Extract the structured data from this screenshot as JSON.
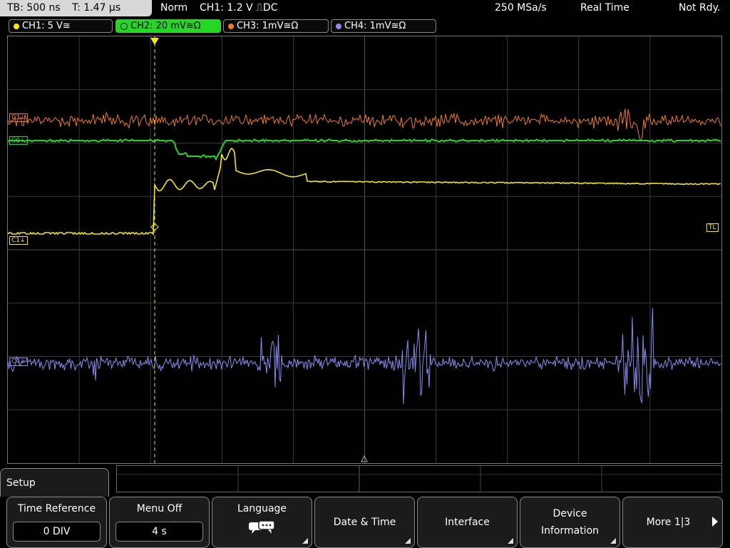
{
  "status": {
    "timebase": "TB: 500 ns",
    "trigger_time": "T: 1.47 µs",
    "mode": "Norm",
    "trigger_source": "CH1: 1.2 V ⎍DC",
    "sample_rate": "250 MSa/s",
    "acquisition": "Real Time",
    "state": "Not Rdy."
  },
  "channels": [
    {
      "label": "CH1: 5 V≅",
      "color": "#f4e81a",
      "active": false
    },
    {
      "label": "CH2: 20 mV≅Ω",
      "color": "#26d626",
      "active": true
    },
    {
      "label": "CH3: 1mV≅Ω",
      "color": "#f07a2a",
      "active": false
    },
    {
      "label": "CH4: 1mV≅Ω",
      "color": "#8a8cf0",
      "active": false
    }
  ],
  "markers": {
    "c1": "C1↓",
    "c2": "C2↓",
    "c3": "C3↓",
    "c4": "C4↓",
    "trigger_level": "TL",
    "trigger_pos": "T"
  },
  "menu": {
    "title": "Setup",
    "softkeys": [
      {
        "label": "Time Reference",
        "value": "0 DIV"
      },
      {
        "label": "Menu Off",
        "value": "4 s"
      },
      {
        "label": "Language",
        "icon": "speech-bubbles-icon"
      },
      {
        "label": "Date & Time"
      },
      {
        "label": "Interface"
      },
      {
        "label_line1": "Device",
        "label_line2": "Information"
      },
      {
        "label": "More 1|3"
      }
    ]
  }
}
